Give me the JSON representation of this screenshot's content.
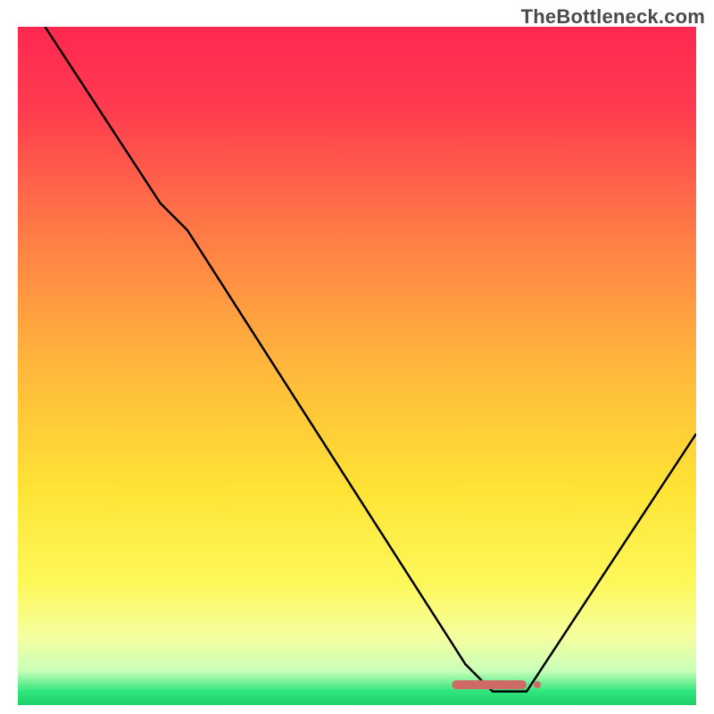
{
  "watermark": "TheBottleneck.com",
  "chart_data": {
    "type": "line",
    "title": "",
    "xlabel": "",
    "ylabel": "",
    "xlim": [
      0,
      100
    ],
    "ylim": [
      0,
      100
    ],
    "grid": false,
    "legend": false,
    "gradient_stops": [
      {
        "offset": 0,
        "color": "#ff2850"
      },
      {
        "offset": 12,
        "color": "#ff3b4f"
      },
      {
        "offset": 30,
        "color": "#ff7a46"
      },
      {
        "offset": 50,
        "color": "#ffb73c"
      },
      {
        "offset": 68,
        "color": "#ffe335"
      },
      {
        "offset": 82,
        "color": "#fdf85a"
      },
      {
        "offset": 90,
        "color": "#f6ffa0"
      },
      {
        "offset": 95,
        "color": "#c8ffb8"
      },
      {
        "offset": 98,
        "color": "#2fe57c"
      },
      {
        "offset": 100,
        "color": "#1fd06a"
      }
    ],
    "series": [
      {
        "name": "bottleneck-curve",
        "type": "line",
        "color": "#000000",
        "points": [
          {
            "x": 4,
            "y": 100
          },
          {
            "x": 21,
            "y": 74
          },
          {
            "x": 25,
            "y": 70
          },
          {
            "x": 66,
            "y": 6
          },
          {
            "x": 70,
            "y": 2
          },
          {
            "x": 75,
            "y": 2
          },
          {
            "x": 100,
            "y": 40
          }
        ]
      },
      {
        "name": "optimal-marker",
        "type": "marker",
        "color": "#d06a66",
        "points": [
          {
            "x": 64,
            "y": 3
          },
          {
            "x": 75,
            "y": 3
          }
        ]
      }
    ]
  }
}
